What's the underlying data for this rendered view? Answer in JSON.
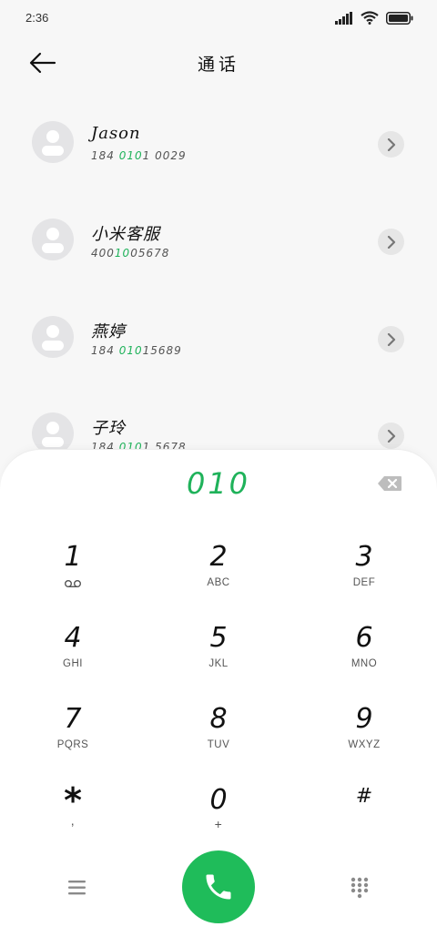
{
  "status_bar": {
    "time": "2:36",
    "icons": [
      "signal-icon",
      "wifi-icon",
      "battery-icon"
    ]
  },
  "header": {
    "title": "通话",
    "back_icon": "back-arrow-icon"
  },
  "contacts": [
    {
      "name": "Jason",
      "number_parts": [
        "184 ",
        "010",
        "1 0029"
      ],
      "highlight": "010"
    },
    {
      "name": "小米客服",
      "number_parts": [
        "400",
        "10",
        "05678"
      ],
      "highlight": "10"
    },
    {
      "name": "燕婷",
      "number_parts": [
        "184 ",
        "010",
        "15689"
      ],
      "highlight": "010"
    },
    {
      "name": "子玲",
      "number_parts": [
        "184 ",
        "010",
        "1 5678"
      ],
      "highlight": "010"
    }
  ],
  "dialer": {
    "display": "010",
    "backspace_icon": "backspace-icon",
    "keys": [
      {
        "digit": "1",
        "letters": "",
        "sub_icon": "voicemail-icon"
      },
      {
        "digit": "2",
        "letters": "ABC"
      },
      {
        "digit": "3",
        "letters": "DEF"
      },
      {
        "digit": "4",
        "letters": "GHI"
      },
      {
        "digit": "5",
        "letters": "JKL"
      },
      {
        "digit": "6",
        "letters": "MNO"
      },
      {
        "digit": "7",
        "letters": "PQRS"
      },
      {
        "digit": "8",
        "letters": "TUV"
      },
      {
        "digit": "9",
        "letters": "WXYZ"
      },
      {
        "digit": "*",
        "letters": ","
      },
      {
        "digit": "0",
        "letters": "+"
      },
      {
        "digit": "#",
        "letters": ""
      }
    ],
    "bottom": {
      "menu_icon": "menu-icon",
      "call_icon": "phone-icon",
      "keypad_icon": "keypad-icon"
    }
  },
  "colors": {
    "accent": "#1fb25a",
    "call_button": "#1fbc5a",
    "background": "#f7f7f7",
    "panel": "#ffffff"
  }
}
